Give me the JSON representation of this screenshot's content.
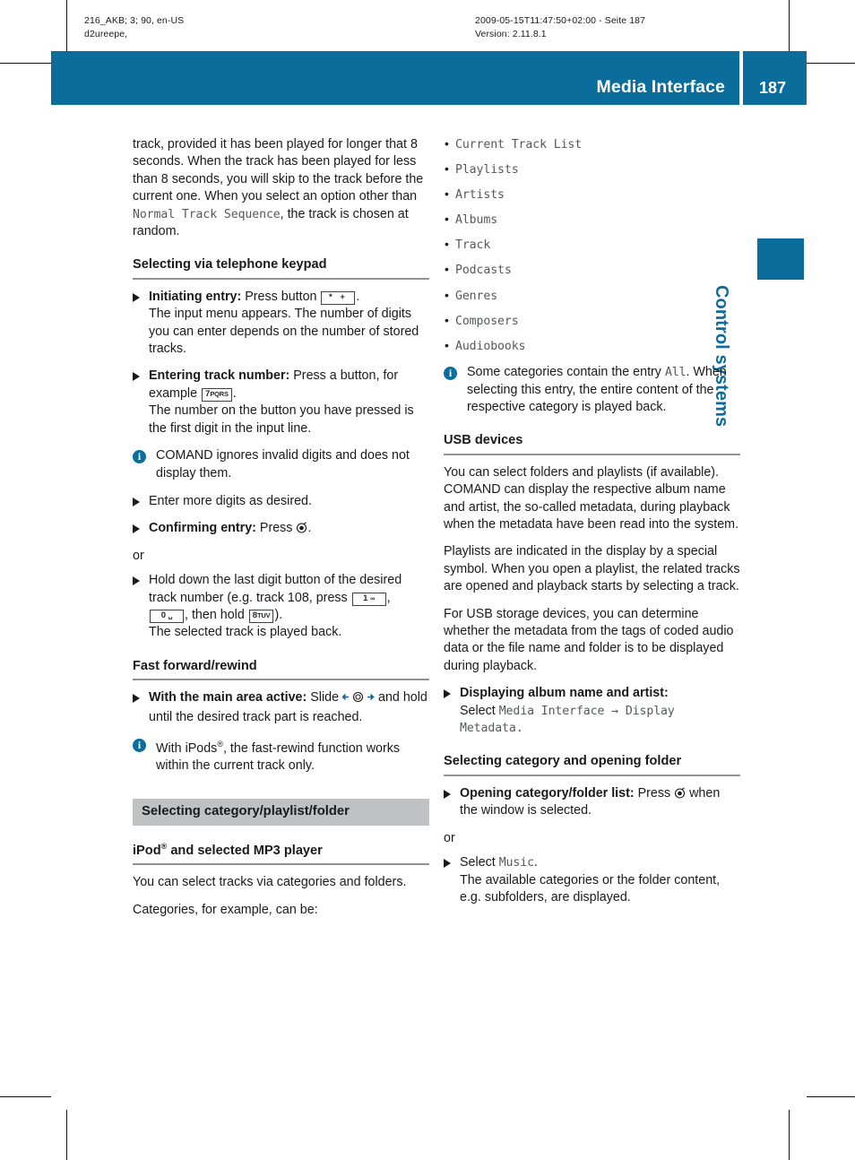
{
  "print_marks": {
    "slug_left": "216_AKB; 3; 90, en-US\nd2ureepe,",
    "slug_right": "2009-05-15T11:47:50+02:00 - Seite 187\nVersion: 2.11.8.1"
  },
  "header": {
    "title": "Media Interface",
    "page_number": "187",
    "band_color": "#0a6d9c"
  },
  "side_tab": {
    "label": "Control systems",
    "color": "#0a6d9c"
  },
  "left_column": {
    "intro_paragraph": {
      "part1": "track, provided it has been played for longer that 8 seconds. When the track has been played for less than 8 seconds, you will skip to the track before the current one. When you select an option other than ",
      "mono_term": "Normal Track Sequence",
      "part2": ", the track is chosen at random."
    },
    "heading_keypad": "Selecting via telephone keypad",
    "step_initiating": {
      "bold": "Initiating entry:",
      "text_before_key": " Press button ",
      "key": "* +",
      "text_after_key": ".",
      "follow_up": "The input menu appears. The number of digits you can enter depends on the number of stored tracks."
    },
    "step_entering": {
      "bold": "Entering track number:",
      "text_before_key": " Press a button, for example ",
      "key_digit": "7",
      "key_letters": "PQRS",
      "text_after_key": ".",
      "follow_up": "The number on the button you have pressed is the first digit in the input line."
    },
    "note_comand": "COMAND ignores invalid digits and does not display them.",
    "step_more_digits": "Enter more digits as desired.",
    "step_confirming": {
      "bold": "Confirming entry:",
      "text": " Press ",
      "icon": "controller-press-icon",
      "suffix": "."
    },
    "or_label_1": "or",
    "step_hold": {
      "text_before": "Hold down the last digit button of the desired track number (e.g. track 108, press ",
      "key1_digit": "1",
      "key1_symbol": "∞",
      "key_sep_1": ", ",
      "key2_digit": "0",
      "key2_symbol": "␣",
      "text_middle": ", then hold ",
      "key3_digit": "8",
      "key3_letters": "TUV",
      "text_after": ").",
      "follow_up": "The selected track is played back."
    },
    "heading_fast_forward": "Fast forward/rewind",
    "step_main_area": {
      "bold": "With the main area active:",
      "text": " Slide ",
      "icon": "slide-left-right-controller-icon",
      "text_after": " and hold until the desired track part is reached."
    },
    "note_ipods": {
      "part1": "With iPods",
      "sup": "®",
      "part2": ", the fast-rewind function works within the current track only."
    },
    "section_bar": "Selecting category/playlist/folder",
    "heading_ipod": {
      "part1": "iPod",
      "sup": "®",
      "part2": " and selected MP3 player"
    },
    "paragraph_select_tracks": "You can select tracks via categories and folders.",
    "paragraph_categories": "Categories, for example, can be:"
  },
  "right_column": {
    "categories": [
      "Current Track List",
      "Playlists",
      "Artists",
      "Albums",
      "Track",
      "Podcasts",
      "Genres",
      "Composers",
      "Audiobooks"
    ],
    "note_all": {
      "part1": "Some categories contain the entry ",
      "mono_term": "All",
      "part2": ". When selecting this entry, the entire content of the respective category is played back."
    },
    "heading_usb": "USB devices",
    "paragraph_usb_1": "You can select folders and playlists (if available). COMAND can display the respective album name and artist, the so-called metadata, during playback when the metadata have been read into the system.",
    "paragraph_usb_2": "Playlists are indicated in the display by a special symbol. When you open a playlist, the related tracks are opened and playback starts by selecting a track.",
    "paragraph_usb_3": "For USB storage devices, you can determine whether the metadata from the tags of coded audio data or the file name and folder is to be displayed during playback.",
    "step_displaying": {
      "bold": "Displaying album name and artist:",
      "text": "Select ",
      "mono_1": "Media Interface",
      "arrow": "→",
      "mono_2": "Display Metadata",
      "suffix": "."
    },
    "heading_selecting_category": "Selecting category and opening folder",
    "step_opening": {
      "bold": "Opening category/folder list:",
      "text": " Press ",
      "icon": "controller-press-icon",
      "text_after": " when the window is selected."
    },
    "or_label": "or",
    "step_select_music": {
      "text": "Select ",
      "mono": "Music",
      "suffix": ".",
      "follow_up": "The available categories or the folder content, e.g. subfolders, are displayed."
    }
  }
}
